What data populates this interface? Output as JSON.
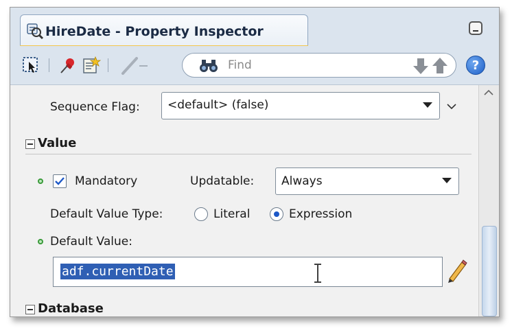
{
  "window": {
    "title": "HireDate - Property Inspector"
  },
  "toolbar": {
    "find_placeholder": "Find"
  },
  "properties": {
    "sequence_flag": {
      "label": "Sequence Flag:",
      "value": "<default> (false)"
    },
    "value_section": {
      "title": "Value",
      "mandatory": {
        "label": "Mandatory",
        "checked": true
      },
      "updatable": {
        "label": "Updatable:",
        "value": "Always"
      },
      "default_value_type": {
        "label": "Default Value Type:",
        "options": [
          "Literal",
          "Expression"
        ],
        "selected": "Expression"
      },
      "default_value": {
        "label": "Default Value:",
        "value": "adf.currentDate"
      }
    },
    "database_section": {
      "title": "Database"
    }
  },
  "colors": {
    "accent_blue": "#2f5fb4",
    "panel_bg": "#dbe4ee",
    "content_bg": "#f1f1f1",
    "modified_dot": "#3a9a3a"
  }
}
